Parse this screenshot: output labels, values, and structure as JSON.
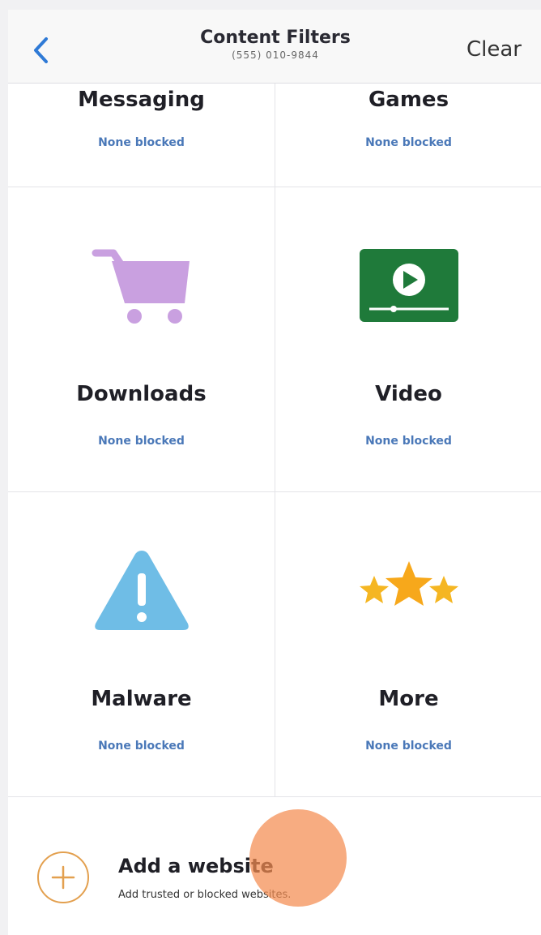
{
  "header": {
    "title": "Content Filters",
    "subtitle": "(555) 010-9844",
    "clear_label": "Clear",
    "back_icon": "chevron-left-icon"
  },
  "filters": [
    {
      "label": "Messaging",
      "status": "None blocked"
    },
    {
      "label": "Games",
      "status": "None blocked"
    },
    {
      "label": "Downloads",
      "status": "None blocked",
      "icon": "shopping-cart-icon",
      "color": "#c9a0e0"
    },
    {
      "label": "Video",
      "status": "None blocked",
      "icon": "video-play-icon",
      "color": "#1f7a3a"
    },
    {
      "label": "Malware",
      "status": "None blocked",
      "icon": "warning-triangle-icon",
      "color": "#6fbde6"
    },
    {
      "label": "More",
      "status": "None blocked",
      "icon": "stars-icon",
      "color": "#f5b622"
    }
  ],
  "add_website": {
    "title": "Add a website",
    "subtitle": "Add trusted or blocked websites.",
    "icon": "plus-circle-icon",
    "accent": "#e3a04f"
  }
}
